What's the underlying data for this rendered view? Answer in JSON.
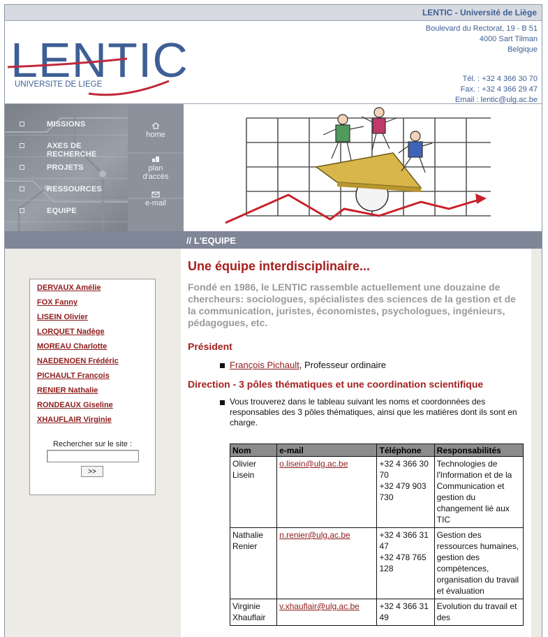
{
  "topbar": {
    "title": "LENTIC - Université de Liège"
  },
  "logo": {
    "wordmark": "LENTIC",
    "subtitle": "UNIVERSITE DE LIEGE"
  },
  "contact": {
    "address1": "Boulevard du Rectorat, 19 - B 51",
    "address2": "4000 Sart Tilman",
    "country": "Belgique",
    "tel": "Tél. : +32 4 366 30 70",
    "fax": "Fax. : +32 4 366 29 47",
    "email": "Email : lentic@ulg.ac.be"
  },
  "nav": {
    "items": [
      {
        "label": "MISSIONS"
      },
      {
        "label": "AXES DE RECHERCHE"
      },
      {
        "label": "PROJETS"
      },
      {
        "label": "RESSOURCES"
      },
      {
        "label": "EQUIPE"
      }
    ],
    "quick": {
      "home": "home",
      "plan1": "plan",
      "plan2": "d'accès",
      "email": "e-mail"
    }
  },
  "section": {
    "title": "// L'EQUIPE"
  },
  "sidebar": {
    "people": [
      "DERVAUX Amélie",
      "FOX Fanny",
      "LISEIN Olivier",
      "LORQUET Nadège",
      "MOREAU Charlotte",
      "NAEDENOEN Frédéric",
      "PICHAULT François",
      "RENIER Nathalie",
      "RONDEAUX Giseline",
      "XHAUFLAIR Virginie"
    ],
    "search": {
      "label": "Rechercher sur le site :",
      "value": "",
      "button": ">>"
    }
  },
  "main": {
    "heading": "Une équipe interdisciplinaire...",
    "intro": "Fondé en 1986, le LENTIC rassemble actuellement une douzaine de chercheurs: sociologues, spécialistes des sciences de la gestion et de la communication, juristes, économistes, psychologues, ingénieurs, pédagogues, etc.",
    "president_heading": "Président",
    "president_link": "François Pichault",
    "president_role": ", Professeur ordinaire",
    "direction_heading": "Direction - 3 pôles thématiques et une coordination scientifique",
    "direction_text": "Vous trouverez dans le tableau suivant les noms et coordonnées des responsables des 3 pôles thématiques, ainsi que les matières dont ils sont en charge.",
    "table": {
      "headers": [
        "Nom",
        "e-mail",
        "Téléphone",
        "Responsabilités"
      ],
      "rows": [
        {
          "name": "Olivier Lisein",
          "email": "o.lisein@ulg.ac.be",
          "phone1": "+32 4 366 30 70",
          "phone2": "+32 479 903 730",
          "resp": "Technologies de l'Information et de la Communication et gestion du changement lié aux TIC"
        },
        {
          "name": "Nathalie Renier",
          "email": "n.renier@ulg.ac.be",
          "phone1": "+32 4 366 31 47",
          "phone2": "+32 478 765 128",
          "resp": "Gestion des ressources humaines, gestion des compétences, organisation du travail et évaluation"
        },
        {
          "name": "Virginie Xhauflair",
          "email": "v.xhauflair@ulg.ac.be",
          "phone1": "+32 4 366 31 49",
          "phone2": "",
          "resp": "Evolution du travail et des"
        }
      ]
    }
  },
  "colors": {
    "brand_blue": "#3e5f96",
    "brand_red": "#a51e1e",
    "link_red": "#8e1b1b",
    "section_bar": "#7e8697"
  }
}
